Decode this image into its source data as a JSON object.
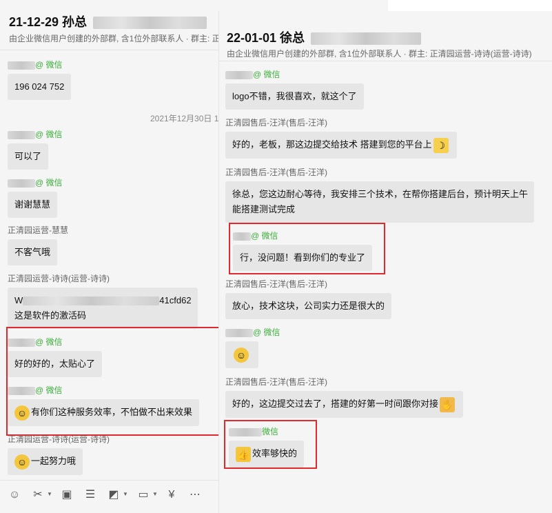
{
  "left_chat": {
    "title": "21-12-29 孙总",
    "subtitle": "由企业微信用户创建的外部群, 含1位外部联系人 · 群主: 正",
    "date_separator": "2021年12月30日 1",
    "messages": [
      {
        "sender_suffix": "@ 微信",
        "text": "196 024 752"
      },
      {
        "sender_suffix": "@ 微信",
        "text": "可以了"
      },
      {
        "sender_suffix": "@ 微信",
        "text": "谢谢慧慧"
      },
      {
        "sender": "正清园运营-慧慧",
        "text": "不客气哦"
      },
      {
        "sender": "正清园运营-诗诗(运营-诗诗)",
        "text_line1_prefix": "W",
        "text_line1_suffix": "41cfd62",
        "text_line2": "这是软件的激活码"
      },
      {
        "sender_suffix": "@ 微信",
        "text": "好的好的，太贴心了"
      },
      {
        "sender_suffix": "@ 微信",
        "text": "有你们这种服务效率，不怕做不出来效果"
      },
      {
        "sender": "正清园运营-诗诗(运营-诗诗)",
        "text": "一起努力哦"
      }
    ]
  },
  "right_chat": {
    "title": "22-01-01 徐总",
    "subtitle": "由企业微信用户创建的外部群, 含1位外部联系人 · 群主: 正清园运营-诗诗(运营-诗诗)",
    "messages": [
      {
        "sender_suffix": "@ 微信",
        "text": "logo不错，我很喜欢，就这个了"
      },
      {
        "sender": "正清园售后-汪洋(售后-汪洋)",
        "text": "好的，老板，那这边提交给技术 搭建到您的平台上"
      },
      {
        "sender": "正清园售后-汪洋(售后-汪洋)",
        "text_line1": "徐总，您这边耐心等待，我安排三个技术，在帮你搭建后台，预计明天上午",
        "text_line2": "能搭建测试完成"
      },
      {
        "sender_suffix": "@ 微信",
        "text": "行，没问题！看到你们的专业了"
      },
      {
        "sender": "正清园售后-汪洋(售后-汪洋)",
        "text": "放心，技术这块，公司实力还是很大的"
      },
      {
        "sender_suffix": "@ 微信",
        "text": ""
      },
      {
        "sender": "正清园售后-汪洋(售后-汪洋)",
        "text": "好的，这边提交过去了，搭建的好第一时间跟你对接"
      },
      {
        "sender_suffix": "微信",
        "text": "效率够快的"
      }
    ]
  },
  "toolbar": {
    "icons": [
      "emoji-icon",
      "scissors-icon",
      "image-icon",
      "document-icon",
      "screenshot-icon",
      "folder-icon",
      "transfer-icon",
      "more-icon",
      "chat-record-icon",
      "sidebar-icon"
    ]
  },
  "colors": {
    "highlight_red": "#e0282d",
    "wechat_green": "#3bad3b",
    "bubble_gray": "#e6e6e6"
  }
}
